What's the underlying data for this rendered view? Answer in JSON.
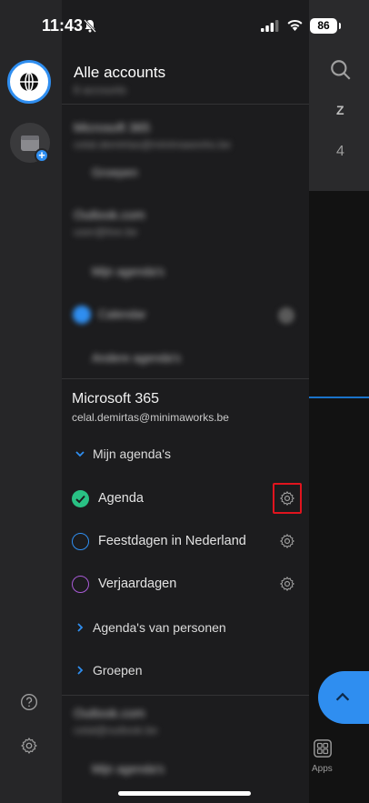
{
  "status_bar": {
    "time": "11:43",
    "battery": "86"
  },
  "drawer": {
    "title": "Alle accounts",
    "title_sub": "8 accounts",
    "blurred_items": [
      {
        "title": "Microsoft 365",
        "sub": "celal.demirtas@minimaworks.be"
      },
      {
        "label": "Groepen"
      },
      {
        "title": "Outlook.com",
        "sub": "user@live.be"
      },
      {
        "label": "Mijn agenda's"
      },
      {
        "label": "Calendar"
      },
      {
        "label": "Andere agenda's"
      }
    ],
    "account": {
      "name": "Microsoft 365",
      "email": "celal.demirtas@minimaworks.be"
    },
    "my_calendars_label": "Mijn agenda's",
    "calendars": [
      {
        "label": "Agenda",
        "checked": true,
        "color": "#29c184"
      },
      {
        "label": "Feestdagen in Nederland",
        "checked": false,
        "color": "#2f8ef0"
      },
      {
        "label": "Verjaardagen",
        "checked": false,
        "color": "#a85ad6"
      }
    ],
    "people_calendars_label": "Agenda's van personen",
    "groups_label": "Groepen",
    "bottom_blurred": [
      {
        "title": "Outlook.com",
        "sub": "celal@outlook.be"
      },
      {
        "label": "Mijn agenda's"
      }
    ]
  },
  "background_app": {
    "letter": "Z",
    "number": "4",
    "apps_label": "Apps"
  },
  "colors": {
    "accent": "#2f8ef0",
    "highlight": "#e0141e"
  }
}
